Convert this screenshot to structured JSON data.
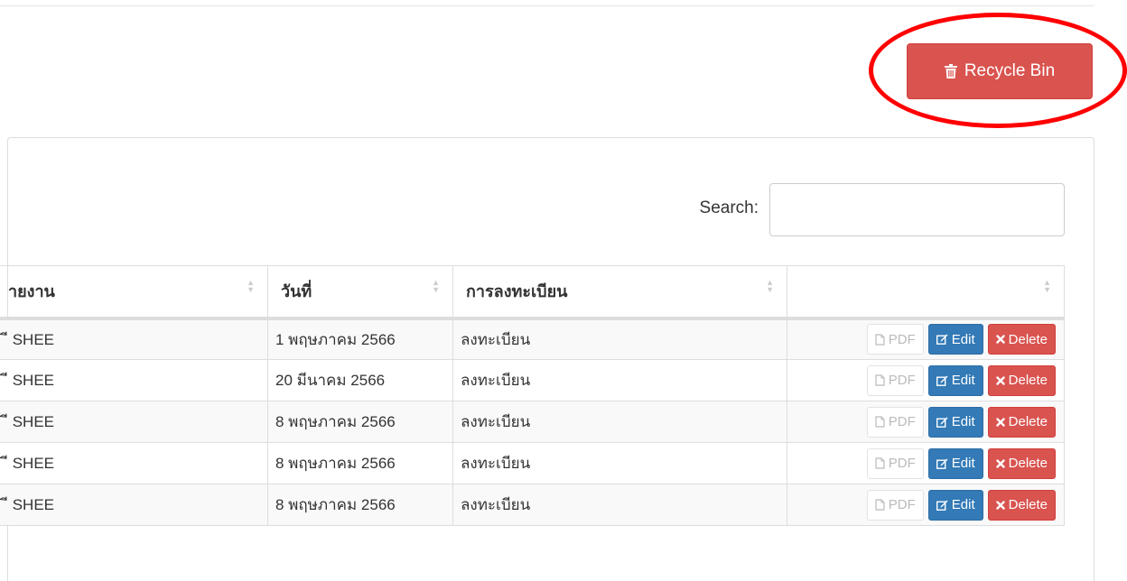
{
  "header": {
    "recycle_bin_label": "Recycle Bin",
    "recycle_bin_icon": "trash-icon"
  },
  "colors": {
    "danger": "#d9534f",
    "primary": "#337ab7",
    "highlight": "#ff0000"
  },
  "search": {
    "label": "Search:",
    "value": "",
    "placeholder": ""
  },
  "table": {
    "columns": [
      "ายงาน",
      "วันที่",
      "การลงทะเบียน",
      ""
    ],
    "rows": [
      {
        "unit": "ี SHEE",
        "date": "1 พฤษภาคม 2566",
        "registration": "ลงทะเบียน"
      },
      {
        "unit": "ี SHEE",
        "date": "20 มีนาคม 2566",
        "registration": "ลงทะเบียน"
      },
      {
        "unit": "ี SHEE",
        "date": "8 พฤษภาคม 2566",
        "registration": "ลงทะเบียน"
      },
      {
        "unit": "ี SHEE",
        "date": "8 พฤษภาคม 2566",
        "registration": "ลงทะเบียน"
      },
      {
        "unit": "ี SHEE",
        "date": "8 พฤษภาคม 2566",
        "registration": "ลงทะเบียน"
      }
    ],
    "actions": {
      "pdf_label": "PDF",
      "edit_label": "Edit",
      "delete_label": "Delete"
    }
  }
}
